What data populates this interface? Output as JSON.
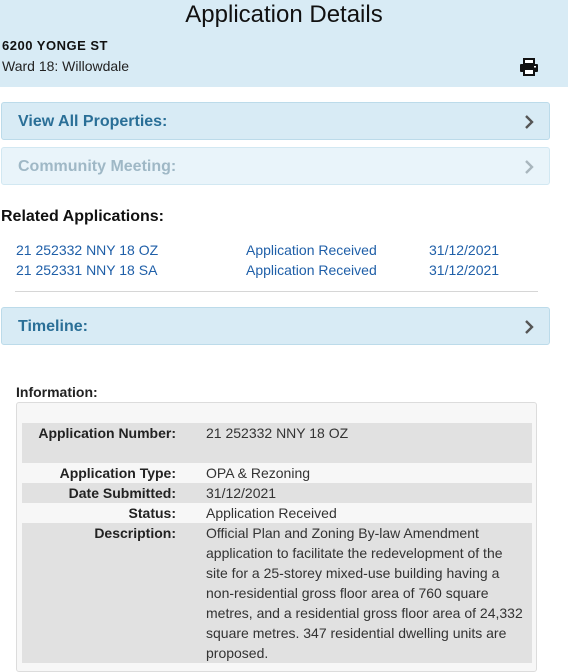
{
  "header": {
    "title": "Application Details",
    "address": "6200 YONGE ST",
    "ward": "Ward 18: Willowdale",
    "print_icon": "printer-icon"
  },
  "accordions": {
    "view_all_properties": "View All Properties:",
    "community_meeting": "Community Meeting:",
    "timeline": "Timeline:"
  },
  "related": {
    "heading": "Related Applications:",
    "items": [
      {
        "number": "21 252332 NNY 18 OZ",
        "status": "Application Received",
        "date": "31/12/2021"
      },
      {
        "number": "21 252331 NNY 18 SA",
        "status": "Application Received",
        "date": "31/12/2021"
      }
    ]
  },
  "information": {
    "heading": "Information:",
    "rows": [
      {
        "label": "Application Number:",
        "value": "21 252332 NNY 18 OZ"
      },
      {
        "label": "Application Type:",
        "value": "OPA & Rezoning"
      },
      {
        "label": "Date Submitted:",
        "value": "31/12/2021"
      },
      {
        "label": "Status:",
        "value": "Application Received"
      },
      {
        "label": "Description:",
        "value": "Official Plan and Zoning By-law Amendment application to facilitate the redevelopment of the site for a 25-storey mixed-use building having a non-residential gross floor area of 760 square metres, and a residential gross floor area of 24,332 square metres. 347 residential dwelling units are proposed."
      }
    ]
  },
  "colors": {
    "header_bg": "#d8ebf5",
    "accent": "#2a6f97",
    "link": "#1f5fa8"
  }
}
